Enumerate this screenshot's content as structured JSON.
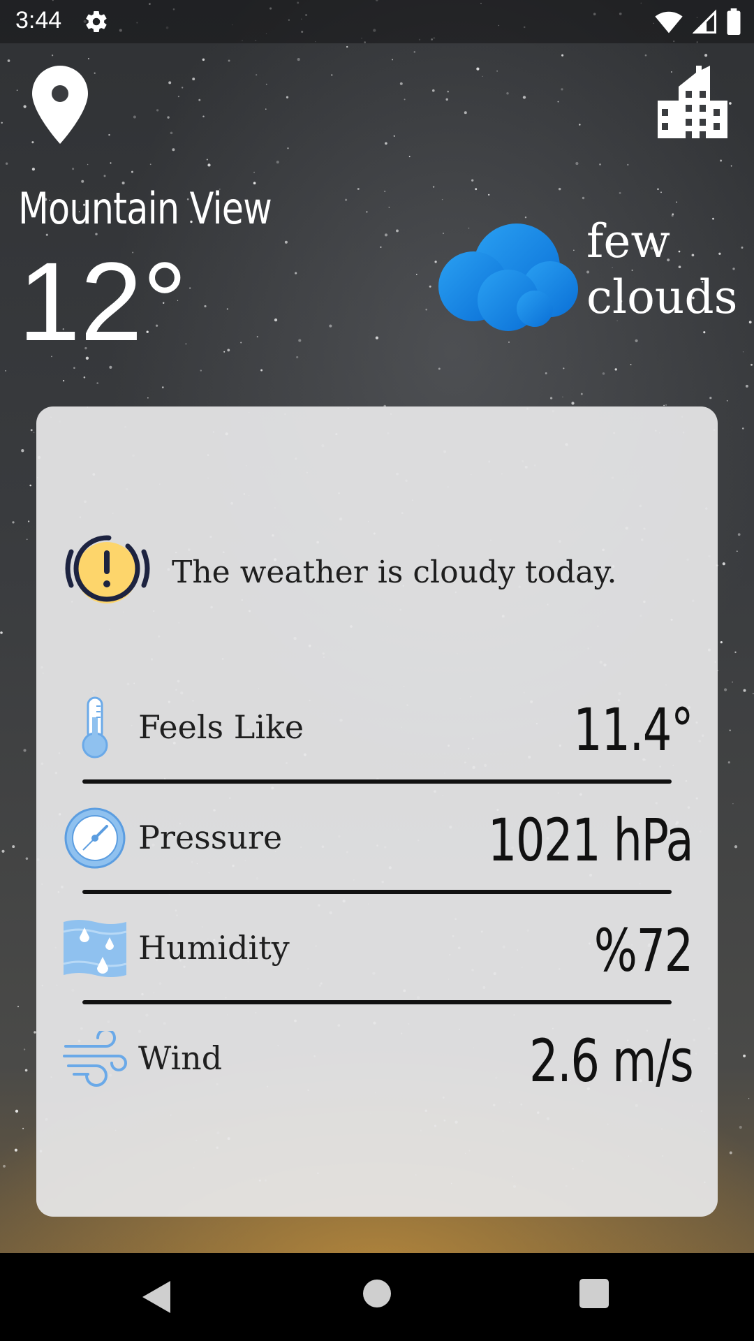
{
  "status_bar": {
    "time": "3:44",
    "icons": [
      "gear-icon",
      "wifi-icon",
      "signal-icon",
      "battery-icon"
    ]
  },
  "header": {
    "location_icon": "map-pin-icon",
    "city_icon": "city-buildings-icon",
    "city": "Mountain View",
    "temperature": "12°",
    "condition_icon": "cloud-icon",
    "condition": "few clouds"
  },
  "card": {
    "alert_icon": "warning-icon",
    "alert_text": "The weather is cloudy today.",
    "rows": [
      {
        "icon": "thermometer-icon",
        "label": "Feels Like",
        "value": "11.4°"
      },
      {
        "icon": "pressure-gauge-icon",
        "label": "Pressure",
        "value": "1021 hPa"
      },
      {
        "icon": "humidity-icon",
        "label": "Humidity",
        "value": "%72"
      },
      {
        "icon": "wind-icon",
        "label": "Wind",
        "value": "2.6 m/s"
      }
    ]
  },
  "nav_bar": {
    "icons": [
      "back-icon",
      "home-icon",
      "recents-icon"
    ]
  },
  "colors": {
    "cloud": "#1a8ae6",
    "alert_yellow": "#fdd56b",
    "icon_blue": "#8fc1ef",
    "card_bg": "#e7e7e8"
  }
}
